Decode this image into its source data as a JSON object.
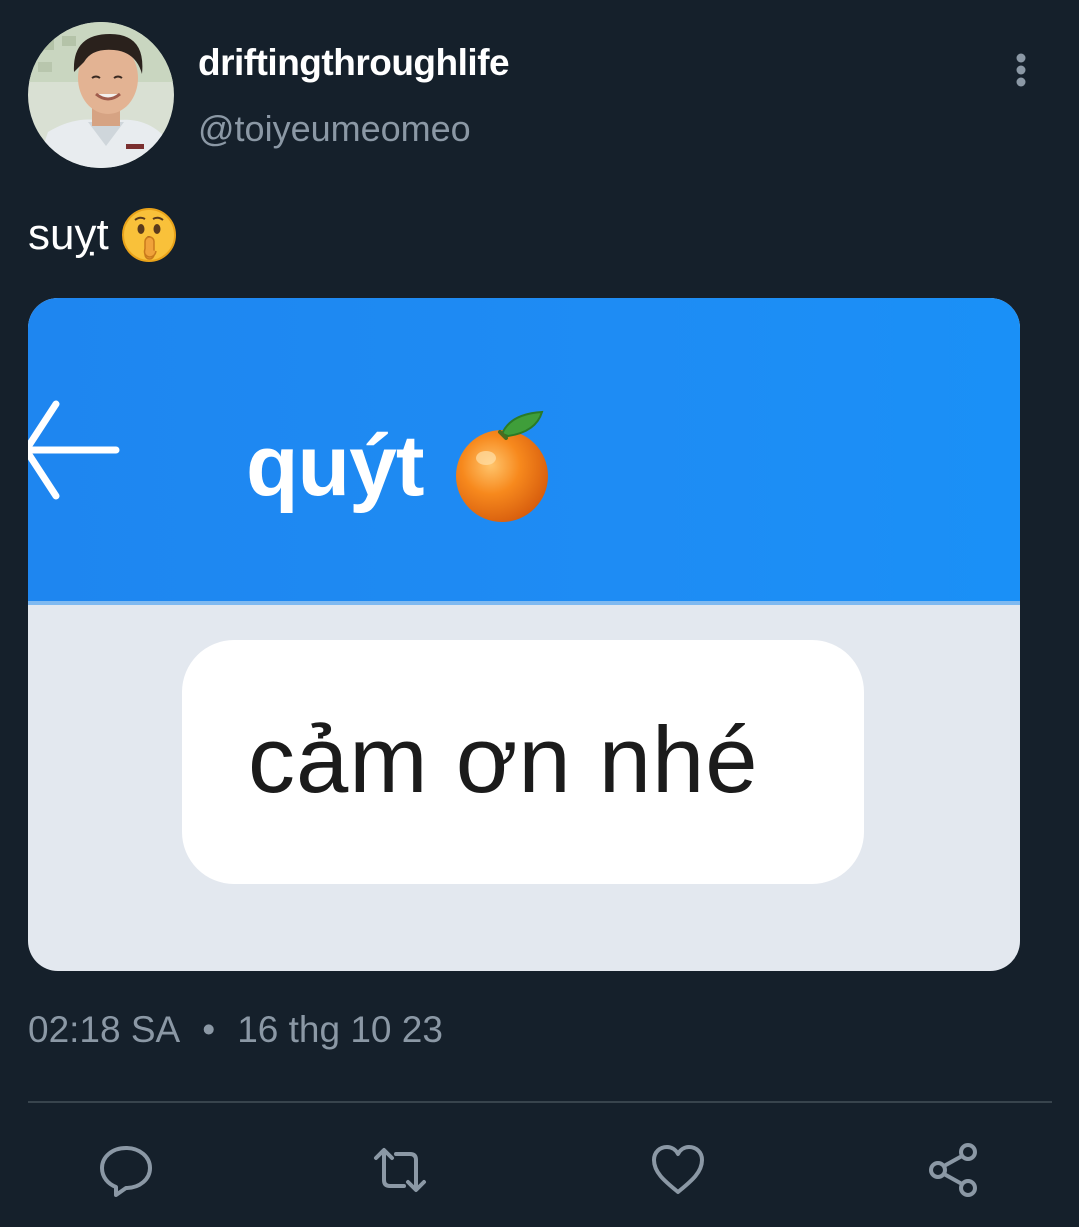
{
  "author": {
    "display_name": "driftingthroughlife",
    "handle": "@toiyeumeomeo"
  },
  "tweet": {
    "text": "suỵt"
  },
  "media": {
    "chat_title": "quýt",
    "message": "cảm ơn nhé"
  },
  "meta": {
    "time": "02:18 SA",
    "separator": "•",
    "date": "16 thg 10 23"
  },
  "icons": {
    "more": "more-vertical-icon",
    "reply": "comment-bubble-icon",
    "retweet": "retweet-icon",
    "like": "heart-icon",
    "share": "share-nodes-icon",
    "shush": "shushing-face-emoji",
    "orange": "tangerine-emoji",
    "back": "back-arrow-icon"
  },
  "colors": {
    "background": "#15202b",
    "secondary_text": "#8b98a5",
    "chat_header_blue": "#1e8cf4",
    "divider": "#38444d"
  }
}
